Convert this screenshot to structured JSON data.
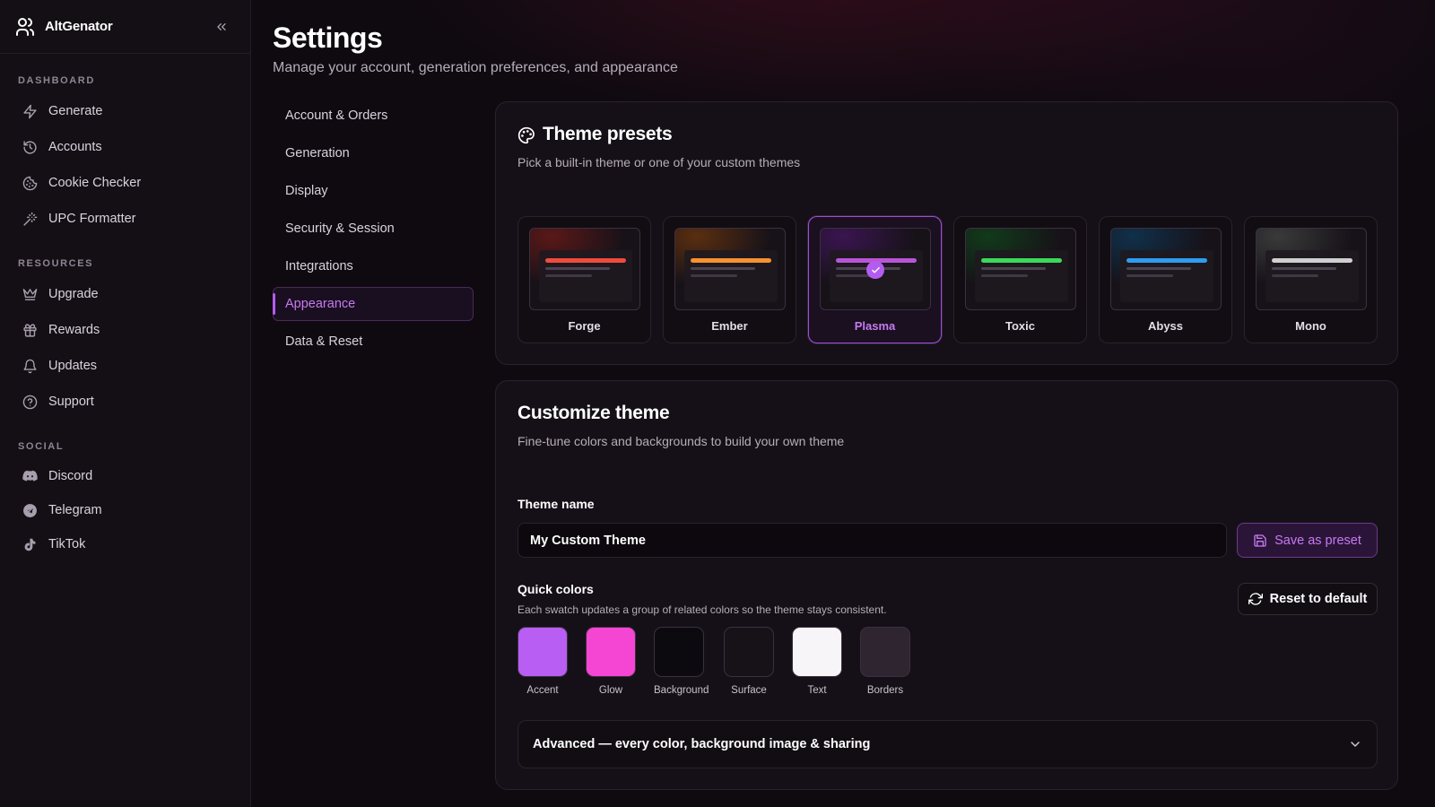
{
  "brand": {
    "name": "AltGenator"
  },
  "sidebar": {
    "sections": {
      "dashboard": "DASHBOARD",
      "resources": "RESOURCES",
      "social": "SOCIAL"
    },
    "dashboard_items": [
      {
        "label": "Generate",
        "icon": "bolt-icon"
      },
      {
        "label": "Accounts",
        "icon": "history-icon"
      },
      {
        "label": "Cookie Checker",
        "icon": "cookie-icon"
      },
      {
        "label": "UPC Formatter",
        "icon": "wand-icon"
      }
    ],
    "resource_items": [
      {
        "label": "Upgrade",
        "icon": "crown-icon"
      },
      {
        "label": "Rewards",
        "icon": "gift-icon"
      },
      {
        "label": "Updates",
        "icon": "bell-icon"
      },
      {
        "label": "Support",
        "icon": "help-circle-icon"
      }
    ],
    "social_items": [
      {
        "label": "Discord",
        "icon": "discord-icon"
      },
      {
        "label": "Telegram",
        "icon": "telegram-icon"
      },
      {
        "label": "TikTok",
        "icon": "tiktok-icon"
      }
    ]
  },
  "page": {
    "title": "Settings",
    "subtitle": "Manage your account, generation preferences, and appearance"
  },
  "subnav": [
    "Account & Orders",
    "Generation",
    "Display",
    "Security & Session",
    "Integrations",
    "Appearance",
    "Data & Reset"
  ],
  "subnav_active": "Appearance",
  "presets": {
    "title": "Theme presets",
    "subtitle": "Pick a built-in theme or one of your custom themes",
    "selected": "Plasma",
    "items": [
      {
        "name": "Forge",
        "accent": "#ef4b3c",
        "glow": "#5a1818"
      },
      {
        "name": "Ember",
        "accent": "#f7922e",
        "glow": "#5a2e10"
      },
      {
        "name": "Plasma",
        "accent": "#b855d6",
        "glow": "#3a1550"
      },
      {
        "name": "Toxic",
        "accent": "#3bd95a",
        "glow": "#123a1a"
      },
      {
        "name": "Abyss",
        "accent": "#2e9cf0",
        "glow": "#10304a"
      },
      {
        "name": "Mono",
        "accent": "#cfcfcf",
        "glow": "#3a3a3a"
      }
    ]
  },
  "customize": {
    "title": "Customize theme",
    "subtitle": "Fine-tune colors and backgrounds to build your own theme",
    "theme_name_label": "Theme name",
    "theme_name_value": "My Custom Theme",
    "save_label": "Save as preset",
    "quick_colors_label": "Quick colors",
    "quick_colors_help": "Each swatch updates a group of related colors so the theme stays consistent.",
    "reset_label": "Reset to default",
    "swatches": [
      {
        "label": "Accent",
        "color": "#b85ef2"
      },
      {
        "label": "Glow",
        "color": "#f545d3"
      },
      {
        "label": "Background",
        "color": "#0d0a0f"
      },
      {
        "label": "Surface",
        "color": "#161218"
      },
      {
        "label": "Text",
        "color": "#f7f5f7"
      },
      {
        "label": "Borders",
        "color": "#2e2530"
      }
    ],
    "advanced_label": "Advanced — every color, background image & sharing"
  }
}
